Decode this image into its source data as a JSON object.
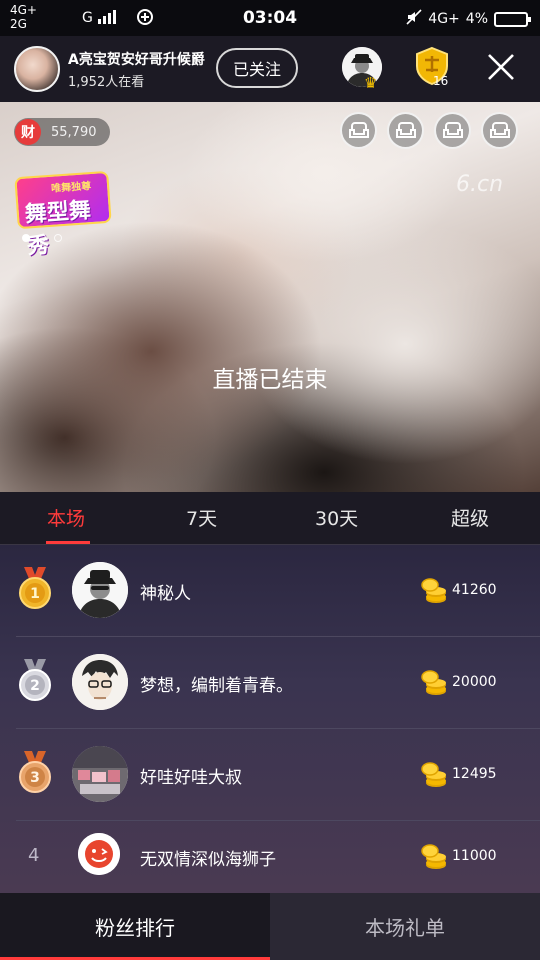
{
  "status_bar": {
    "net_line1": "4G+",
    "net_line2": "2G",
    "net_g": "G",
    "time": "03:04",
    "net_right": "4G+",
    "battery": "4%"
  },
  "header": {
    "host_name": "A亮宝贺安好哥升候爵",
    "viewers": "1,952人在看",
    "follow_label": "已关注",
    "guard_count": "16"
  },
  "stream": {
    "wealth_icon_label": "财",
    "wealth_value": "55,790",
    "seat_icon": "sofa-icon",
    "seat_count": 4,
    "promo_top": "唯舞独尊",
    "promo_main": "舞型舞秀",
    "watermark": "6.cn",
    "ended_text": "直播已结束"
  },
  "rank_tabs": [
    {
      "label": "本场",
      "active": true
    },
    {
      "label": "7天",
      "active": false
    },
    {
      "label": "30天",
      "active": false
    },
    {
      "label": "超级",
      "active": false
    }
  ],
  "ranking": [
    {
      "rank": "1",
      "name": "神秘人",
      "score": "41260",
      "medal": "gold"
    },
    {
      "rank": "2",
      "name": "梦想，编制着青春。",
      "score": "20000",
      "medal": "silver"
    },
    {
      "rank": "3",
      "name": "好哇好哇大叔",
      "score": "12495",
      "medal": "bronze"
    },
    {
      "rank": "4",
      "name": "无双情深似海狮子",
      "score": "11000",
      "medal": "none"
    }
  ],
  "bottom_tabs": {
    "fans_ranking": "粉丝排行",
    "gift_list": "本场礼单"
  },
  "colors": {
    "accent": "#ff3b3b",
    "header_bg": "#1c1a24",
    "coin": "#f5b800"
  }
}
